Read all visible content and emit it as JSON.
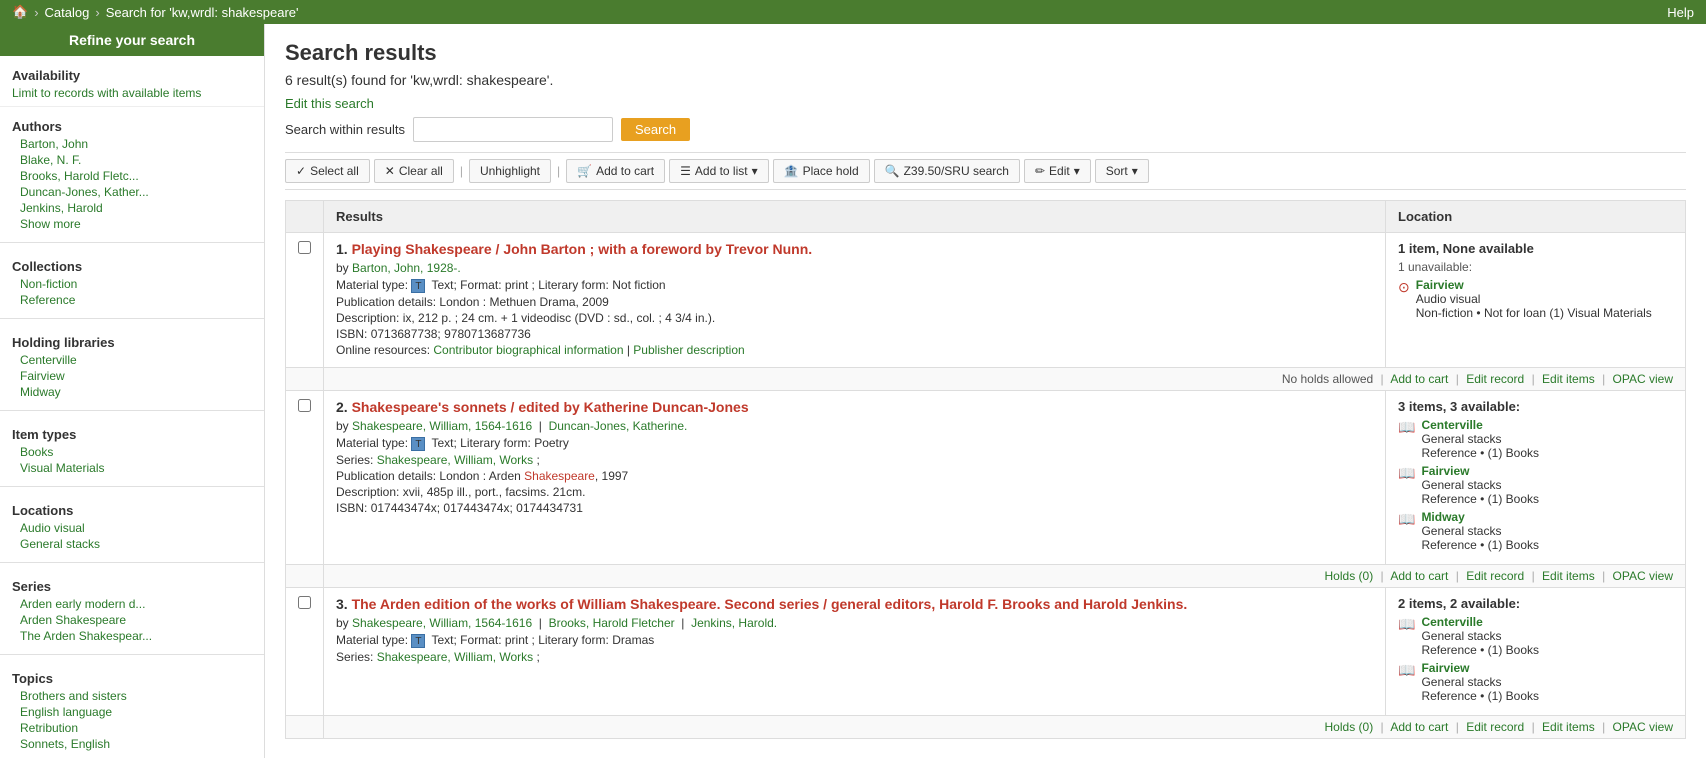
{
  "topNav": {
    "homeIcon": "🏠",
    "breadcrumbs": [
      "Catalog",
      "Search for 'kw,wrdl: shakespeare'"
    ],
    "helpLabel": "Help"
  },
  "sidebar": {
    "header": "Refine your search",
    "availability": {
      "title": "Availability",
      "link": "Limit to records with available items"
    },
    "authors": {
      "title": "Authors",
      "items": [
        "Barton, John",
        "Blake, N. F.",
        "Brooks, Harold Fletc...",
        "Duncan-Jones, Kather...",
        "Jenkins, Harold",
        "Show more"
      ]
    },
    "collections": {
      "title": "Collections",
      "items": [
        "Non-fiction",
        "Reference"
      ]
    },
    "holdingLibraries": {
      "title": "Holding libraries",
      "items": [
        "Centerville",
        "Fairview",
        "Midway"
      ]
    },
    "itemTypes": {
      "title": "Item types",
      "items": [
        "Books",
        "Visual Materials"
      ]
    },
    "locations": {
      "title": "Locations",
      "items": [
        "Audio visual",
        "General stacks"
      ]
    },
    "series": {
      "title": "Series",
      "items": [
        "Arden early modern d...",
        "Arden Shakespeare",
        "The Arden Shakespear..."
      ]
    },
    "topics": {
      "title": "Topics",
      "items": [
        "Brothers and sisters",
        "English language",
        "Retribution",
        "Sonnets, English"
      ]
    }
  },
  "main": {
    "pageTitle": "Search results",
    "resultCount": "6 result(s) found for 'kw,wrdl: shakespeare'.",
    "editSearchLabel": "Edit this search",
    "searchWithin": {
      "label": "Search within results",
      "placeholder": "",
      "buttonLabel": "Search"
    },
    "actionBar": {
      "selectAll": "Select all",
      "clearAll": "Clear all",
      "unhighlight": "Unhighlight",
      "addToCart": "Add to cart",
      "addToList": "Add to list",
      "placeHold": "Place hold",
      "z3950": "Z39.50/SRU search",
      "edit": "Edit",
      "sort": "Sort"
    },
    "tableHeaders": {
      "results": "Results",
      "location": "Location"
    },
    "results": [
      {
        "number": "1.",
        "title": "Playing Shakespeare / John Barton ; with a foreword by Trevor Nunn.",
        "titleHighlight": "Shakespeare",
        "author": "Barton, John, 1928-.",
        "materialType": "Text",
        "format": "print",
        "literaryForm": "Not fiction",
        "pubDetails": "London : Methuen Drama, 2009",
        "description": "ix, 212 p. ; 24 cm. + 1 videodisc (DVD : sd., col. ; 4 3/4 in.).",
        "isbn": "0713687738; 9780713687736",
        "onlineResources": [
          "Contributor biographical information",
          "Publisher description"
        ],
        "rowActions": [
          "No holds allowed",
          "Add to cart",
          "Edit record",
          "Edit items",
          "OPAC view"
        ],
        "location": {
          "count": "1 item, None available",
          "unavail": "1 unavailable:",
          "items": [
            {
              "iconType": "av",
              "libraryName": "Fairview",
              "sublocation": "Audio visual",
              "details": "Non-fiction • Not for loan  (1)  Visual Materials"
            }
          ]
        }
      },
      {
        "number": "2.",
        "title": "Shakespeare's sonnets / edited by Katherine Duncan-Jones",
        "titleHighlight": "Shakespeare",
        "author": "Shakespeare, William, 1564-1616",
        "author2": "Duncan-Jones, Katherine.",
        "materialType": "Text",
        "literaryForm": "Poetry",
        "series": "Shakespeare, William, Works ;",
        "pubDetails": "London : Arden Shakespeare, 1997",
        "description": "xvii, 485p ill., port., facsims. 21cm.",
        "isbn": "017443474x; 017443474x; 0174434731",
        "rowActions": [
          "Holds (0)",
          "Add to cart",
          "Edit record",
          "Edit items",
          "OPAC view"
        ],
        "location": {
          "count": "3 items, 3 available:",
          "items": [
            {
              "iconType": "book",
              "libraryName": "Centerville",
              "sublocation": "General stacks",
              "details": "Reference • (1)  Books"
            },
            {
              "iconType": "book",
              "libraryName": "Fairview",
              "sublocation": "General stacks",
              "details": "Reference • (1)  Books"
            },
            {
              "iconType": "book",
              "libraryName": "Midway",
              "sublocation": "General stacks",
              "details": "Reference • (1)  Books"
            }
          ]
        }
      },
      {
        "number": "3.",
        "title": "The Arden edition of the works of William Shakespeare. Second series / general editors, Harold F. Brooks and Harold Jenkins.",
        "titleHighlight": "Shakespeare",
        "author": "Shakespeare, William, 1564-1616",
        "author2": "Brooks, Harold Fletcher",
        "author3": "Jenkins, Harold.",
        "materialType": "Text",
        "format": "print",
        "literaryForm": "Dramas",
        "series": "Shakespeare, William, Works ;",
        "rowActions": [
          "Holds (0)",
          "Add to cart",
          "Edit record",
          "Edit items",
          "OPAC view"
        ],
        "location": {
          "count": "2 items, 2 available:",
          "items": [
            {
              "iconType": "book",
              "libraryName": "Centerville",
              "sublocation": "General stacks",
              "details": "Reference • (1)  Books"
            },
            {
              "iconType": "book",
              "libraryName": "Fairview",
              "sublocation": "General stacks",
              "details": "Reference • (1)  Books"
            }
          ]
        }
      }
    ]
  }
}
